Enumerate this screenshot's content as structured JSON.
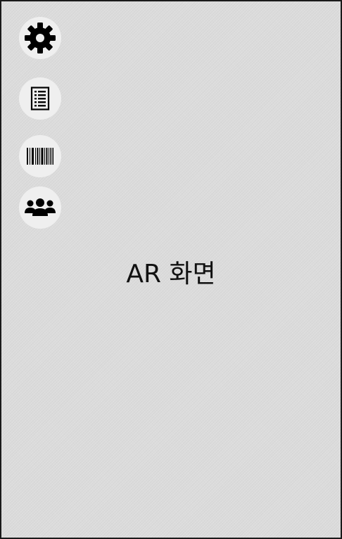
{
  "background_color": "#dcdcdc",
  "buttons": [
    {
      "id": "settings",
      "icon": "gear-icon"
    },
    {
      "id": "document",
      "icon": "document-list-icon"
    },
    {
      "id": "barcode",
      "icon": "barcode-icon"
    },
    {
      "id": "group",
      "icon": "group-icon"
    }
  ],
  "main": {
    "label": "AR 화면"
  }
}
